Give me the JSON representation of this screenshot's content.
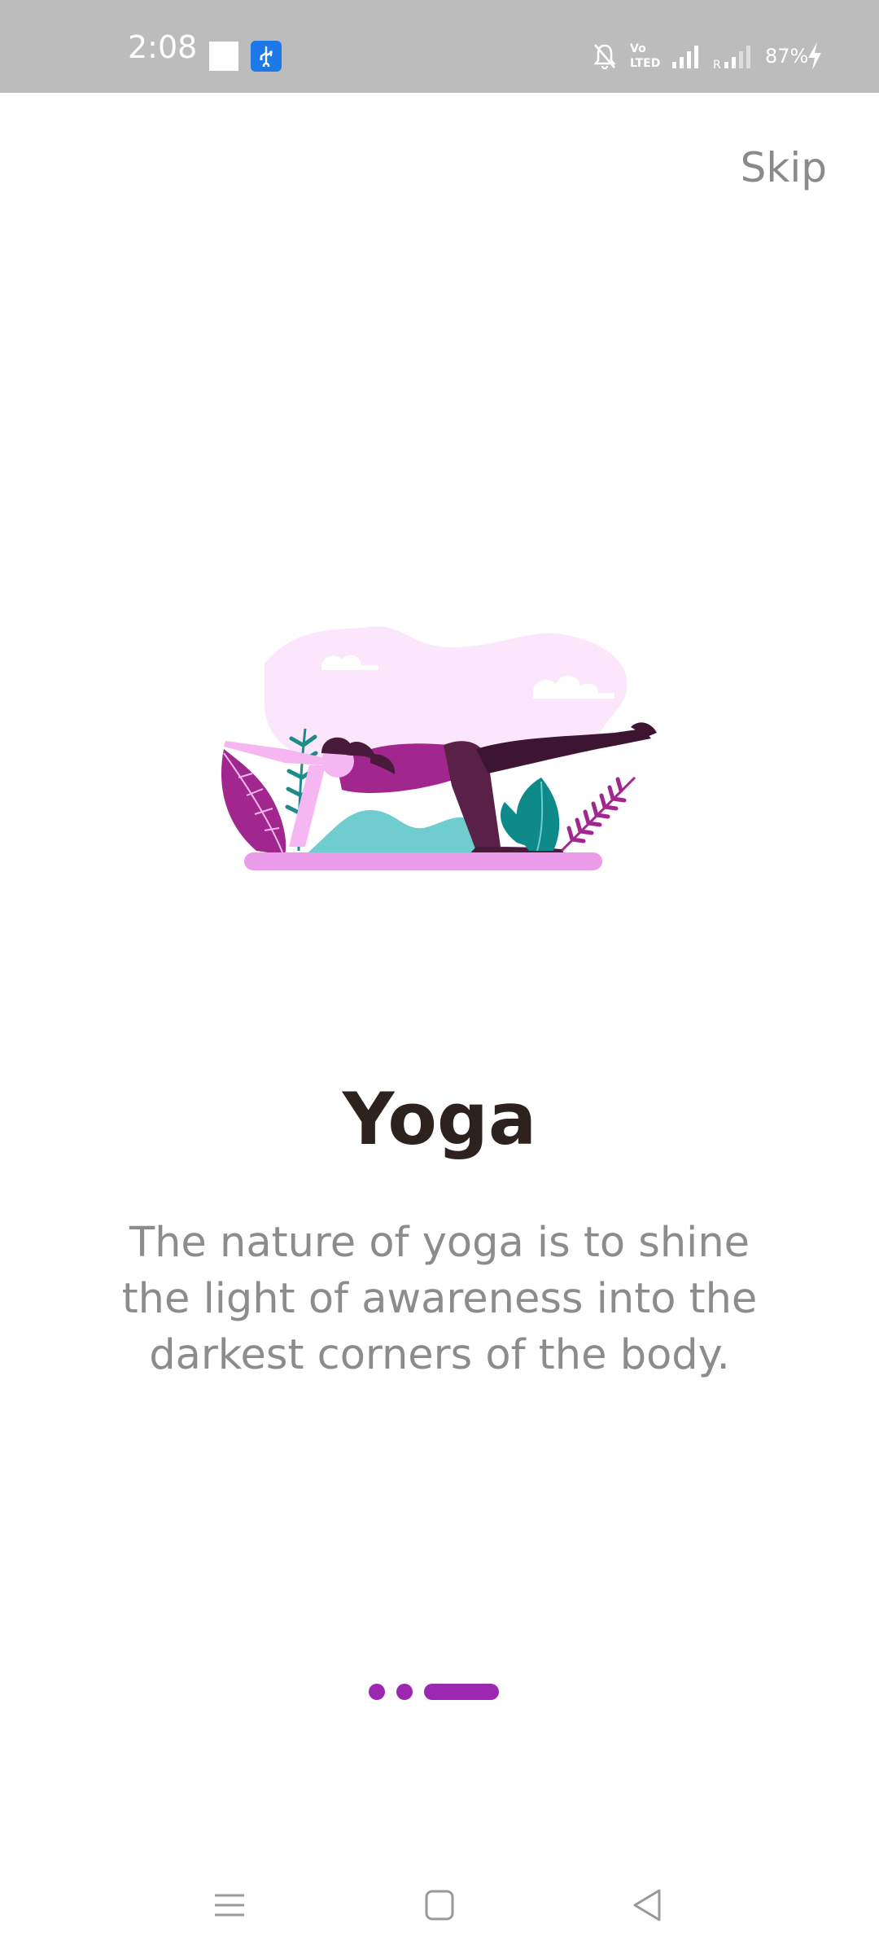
{
  "status_bar": {
    "time": "2:08",
    "battery": "87%",
    "icons": [
      "white-square-notification-icon",
      "usb-icon",
      "mute-icon",
      "volte-icon",
      "signal-icon",
      "roaming-signal-icon",
      "charging-icon"
    ]
  },
  "onboarding": {
    "skip_label": "Skip",
    "title": "Yoga",
    "description": "The nature of yoga is to shine the light of awareness into the darkest corners of the body.",
    "page_indicator": {
      "pages": 3,
      "current": 3
    }
  },
  "nav_bar": {
    "buttons": [
      "menu-icon",
      "home-icon",
      "back-icon"
    ]
  },
  "colors": {
    "accent": "#9c27b0",
    "status_bar_bg": "#bcbcbc",
    "title": "#2e221f",
    "body_text": "#8c8c8c",
    "skip_text": "#8a8a8a"
  }
}
